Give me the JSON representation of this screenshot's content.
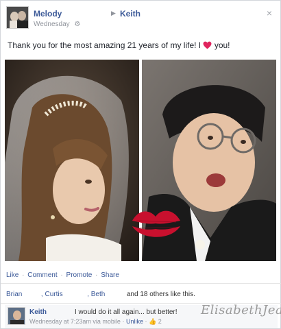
{
  "post": {
    "author": "Melody",
    "target": "Keith",
    "arrow": "▶",
    "timestamp": "Wednesday",
    "globe": "⚙",
    "close": "×",
    "status_before": "Thank you for the most amazing 21 years of my life! I",
    "status_after": "you!"
  },
  "photos": {
    "left_desc": "bride photo",
    "right_desc": "groom photo"
  },
  "actions": {
    "like": "Like",
    "comment": "Comment",
    "promote": "Promote",
    "share": "Share",
    "sep": "·"
  },
  "likes": {
    "name1": "Brian",
    "name2": ", Curtis",
    "name3": ", Beth",
    "rest": "and 18 others like this."
  },
  "comment": {
    "author": "Keith",
    "text": "I would do it all again... but better!",
    "meta_time": "Wednesday at 7:23am via mobile",
    "unlike": "Unlike",
    "sep": "·",
    "thumb": "👍",
    "like_count": "2"
  },
  "watermark": "ElisabethJean",
  "colors": {
    "link": "#3b5998",
    "heart": "#e0245e",
    "kiss": "#c8102e"
  }
}
